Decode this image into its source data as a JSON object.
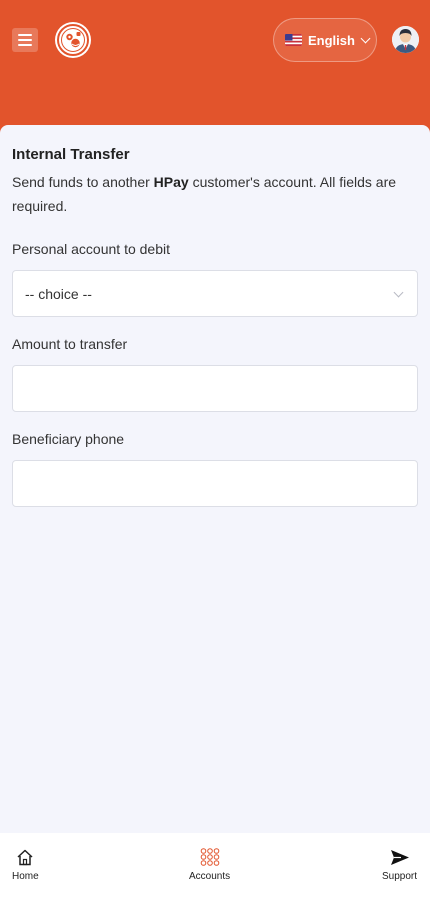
{
  "header": {
    "language_label": "English"
  },
  "form": {
    "title": "Internal Transfer",
    "subtitle_before": "Send funds to another ",
    "subtitle_brand": "HPay",
    "subtitle_after": " customer's account. All fields are required.",
    "debit_account": {
      "label": "Personal account to debit",
      "selected": "-- choice --"
    },
    "amount": {
      "label": "Amount to transfer",
      "value": ""
    },
    "phone": {
      "label": "Beneficiary phone",
      "value": ""
    }
  },
  "bottom_nav": {
    "home": "Home",
    "accounts": "Accounts",
    "support": "Support"
  },
  "colors": {
    "brand": "#e2542c",
    "background": "#f4f5fc"
  }
}
